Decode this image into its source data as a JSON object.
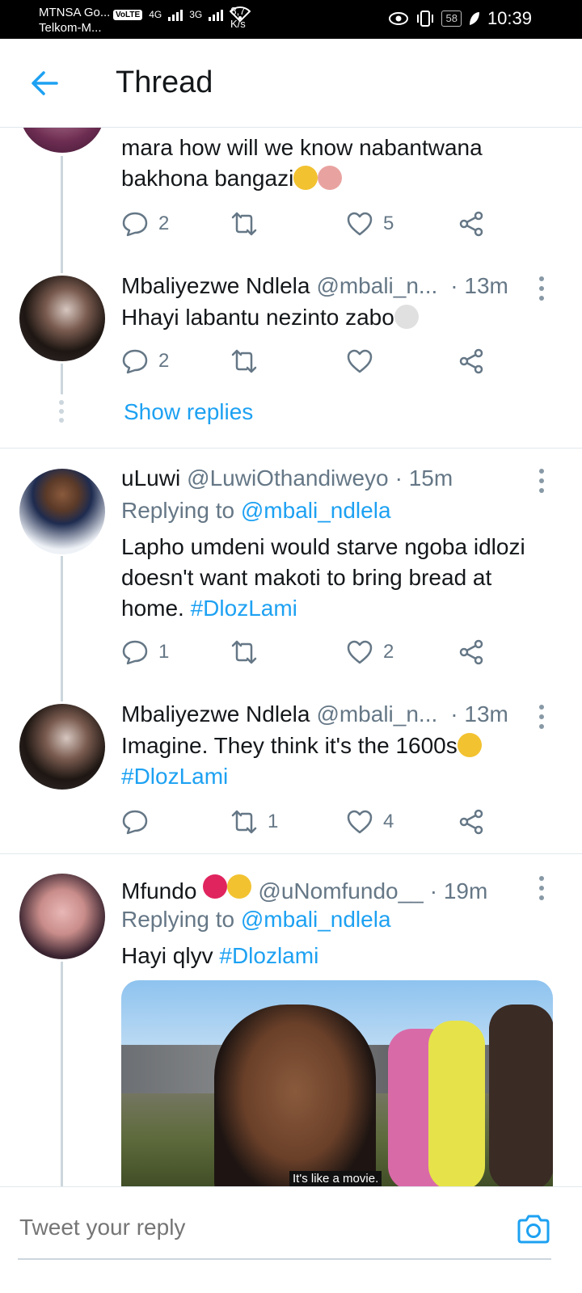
{
  "status_bar": {
    "carrier1": "MTNSA Go...",
    "carrier2": "Telkom-M...",
    "volte": "VoLTE",
    "net1": "4G",
    "net2": "3G",
    "speed_value": "8,7",
    "speed_unit": "K/s",
    "battery": "58",
    "time": "10:39"
  },
  "header": {
    "title": "Thread"
  },
  "tweets": [
    {
      "text": "mara how will we know nabantwana bakhona bangazi",
      "reply_count": "2",
      "like_count": "5",
      "emoji": "😭🙅"
    },
    {
      "name": "Mbaliyezwe Ndlela",
      "handle": "@mbali_n...",
      "time": "· 13m",
      "text": "Hhayi labantu nezinto zabo",
      "emoji": "💀",
      "reply_count": "2"
    },
    {
      "name": "uLuwi",
      "handle": "@LuwiOthandiweyo",
      "time": "· 15m",
      "replying_prefix": "Replying to",
      "replying_to": "@mbali_ndlela",
      "text": "Lapho umdeni would starve ngoba idlozi doesn't want makoti to bring bread at home.",
      "hashtag": "#DlozLami",
      "reply_count": "1",
      "like_count": "2"
    },
    {
      "name": "Mbaliyezwe Ndlela",
      "handle": "@mbali_n...",
      "time": "· 13m",
      "text": "Imagine. They think it's the 1600s",
      "emoji": "😩",
      "hashtag": "#DlozLami",
      "retweet_count": "1",
      "like_count": "4"
    },
    {
      "name": "Mfundo",
      "name_emoji": "❤😊",
      "handle": "@uNomfundo__",
      "time": "· 19m",
      "replying_prefix": "Replying to",
      "replying_to": "@mbali_ndlela",
      "text": "Hayi qlyv",
      "hashtag": "#Dlozlami",
      "media_caption": "It's like a movie."
    }
  ],
  "show_replies": "Show replies",
  "reply_bar": {
    "placeholder": "Tweet your reply"
  },
  "colors": {
    "accent": "#1da1f2",
    "text": "#14171a",
    "muted": "#657786",
    "divider": "#e1e8ed"
  }
}
